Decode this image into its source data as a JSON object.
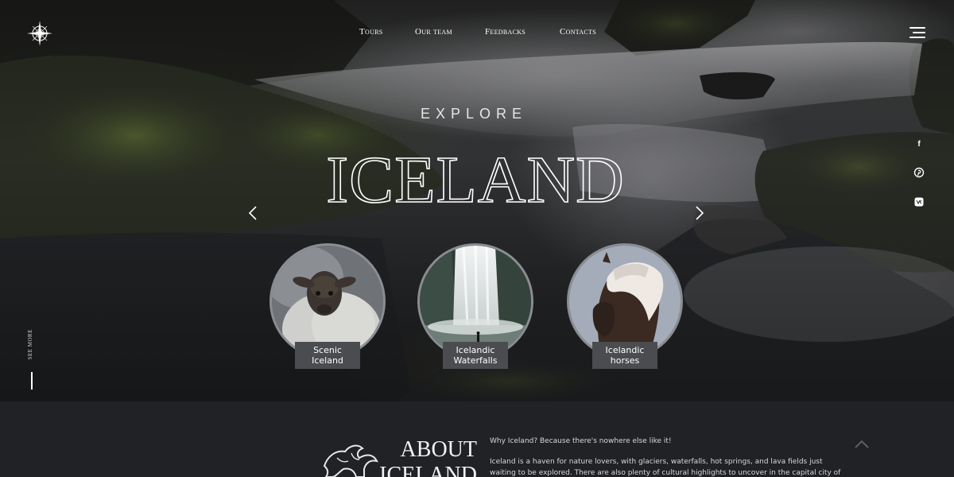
{
  "nav": {
    "items": [
      "Tours",
      "Our team",
      "Feedbacks",
      "Contacts"
    ]
  },
  "hero": {
    "kicker": "EXPLORE",
    "title": "ICELAND",
    "see_more": "SEE MORE"
  },
  "social": [
    "facebook-icon",
    "pinterest-icon",
    "vk-icon"
  ],
  "cards": [
    {
      "line1": "Scenic",
      "line2": "Iceland",
      "image": "sheep"
    },
    {
      "line1": "Icelandic",
      "line2": "Waterfalls",
      "image": "waterfall"
    },
    {
      "line1": "Icelandic",
      "line2": "horses",
      "image": "horse"
    }
  ],
  "about": {
    "title_line1": "ABOUT",
    "title_line2": "ICELAND",
    "question": "Why Iceland? Because there's nowhere else like it!",
    "paragraph": "Iceland is a haven for nature lovers, with glaciers, waterfalls, hot springs, and lava fields just waiting to be explored. There are also plenty of cultural highlights to uncover in the capital city of Reykjavik and beyond."
  },
  "colors": {
    "about_bg": "#212226",
    "card_label_bg": "#4b4c50",
    "circle_border": "#8a8d92"
  }
}
